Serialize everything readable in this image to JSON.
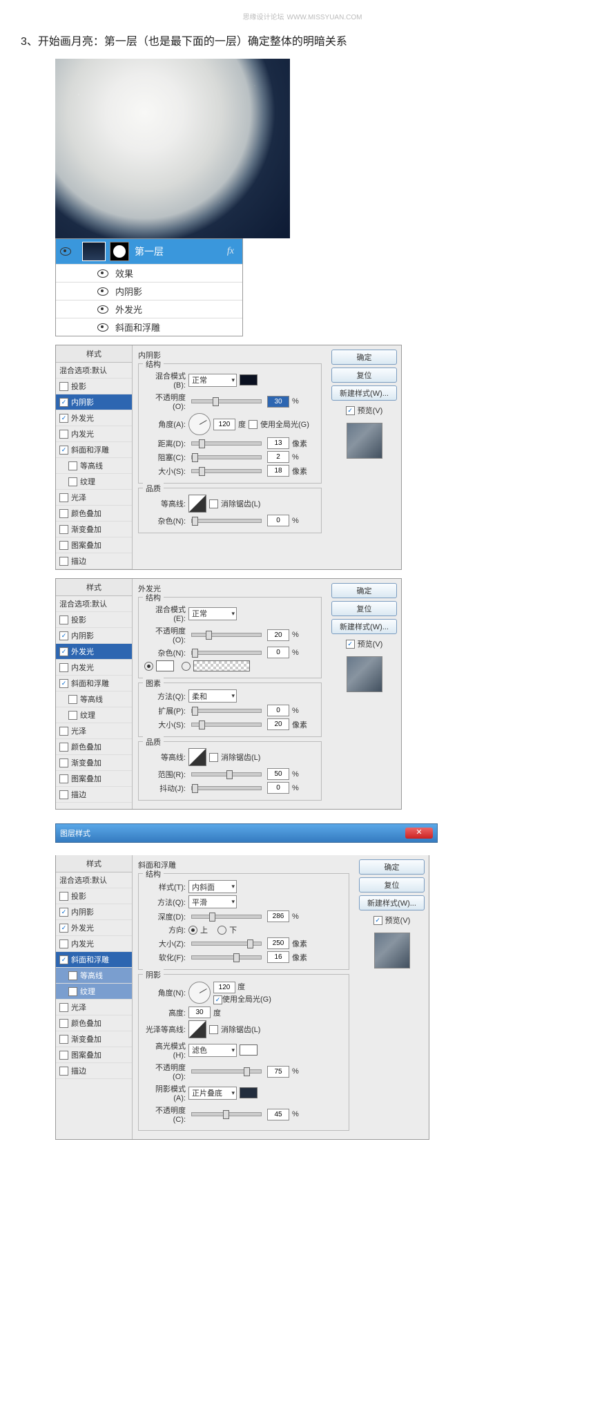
{
  "watermark": {
    "text": "思缘设计论坛",
    "url": "WWW.MISSYUAN.COM"
  },
  "step": "3、开始画月亮：第一层（也是最下面的一层）确定整体的明暗关系",
  "layers": {
    "name": "第一层",
    "fx": "fx",
    "effects_label": "效果",
    "fx_items": [
      "内阴影",
      "外发光",
      "斜面和浮雕"
    ]
  },
  "style_list": {
    "header": "样式",
    "blend_default": "混合选项:默认",
    "items": {
      "drop_shadow": "投影",
      "inner_shadow": "内阴影",
      "outer_glow": "外发光",
      "inner_glow": "内发光",
      "bevel": "斜面和浮雕",
      "contour": "等高线",
      "texture": "纹理",
      "gloss": "光泽",
      "color_overlay": "颜色叠加",
      "grad_overlay": "渐变叠加",
      "pattern_overlay": "图案叠加",
      "stroke": "描边"
    }
  },
  "buttons": {
    "ok": "确定",
    "reset": "复位",
    "new_style": "新建样式(W)...",
    "preview": "预览(V)"
  },
  "inner_shadow": {
    "title": "内阴影",
    "struct": "结构",
    "blend_mode_label": "混合模式(B):",
    "blend_mode": "正常",
    "opacity_label": "不透明度(O):",
    "opacity": "30",
    "opacity_unit": "%",
    "angle_label": "角度(A):",
    "angle": "120",
    "angle_unit": "度",
    "global_light": "使用全局光(G)",
    "distance_label": "距离(D):",
    "distance": "13",
    "px": "像素",
    "spread_label": "阻塞(C):",
    "spread": "2",
    "spread_unit": "%",
    "size_label": "大小(S):",
    "size": "18",
    "quality": "品质",
    "contour_label": "等高线:",
    "aa": "消除锯齿(L)",
    "noise_label": "杂色(N):",
    "noise": "0"
  },
  "outer_glow": {
    "title": "外发光",
    "struct": "结构",
    "blend_mode_label": "混合模式(E):",
    "blend_mode": "正常",
    "opacity_label": "不透明度(O):",
    "opacity": "20",
    "pct": "%",
    "noise_label": "杂色(N):",
    "noise": "0",
    "elements": "图素",
    "method_label": "方法(Q):",
    "method": "柔和",
    "spread_label": "扩展(P):",
    "spread": "0",
    "size_label": "大小(S):",
    "size": "20",
    "px": "像素",
    "quality": "品质",
    "contour_label": "等高线:",
    "aa": "消除锯齿(L)",
    "range_label": "范围(R):",
    "range": "50",
    "jitter_label": "抖动(J):",
    "jitter": "0"
  },
  "bevel": {
    "win_title": "图层样式",
    "title": "斜面和浮雕",
    "struct": "结构",
    "style_label": "样式(T):",
    "style": "内斜面",
    "method_label": "方法(Q):",
    "method": "平滑",
    "depth_label": "深度(D):",
    "depth": "286",
    "pct": "%",
    "direction_label": "方向:",
    "up": "上",
    "down": "下",
    "size_label": "大小(Z):",
    "size": "250",
    "px": "像素",
    "soften_label": "软化(F):",
    "soften": "16",
    "shade": "阴影",
    "angle_label": "角度(N):",
    "angle": "120",
    "deg": "度",
    "global_light": "使用全局光(G)",
    "altitude_label": "高度:",
    "altitude": "30",
    "gloss_contour_label": "光泽等高线:",
    "aa": "消除锯齿(L)",
    "hmode_label": "高光模式(H):",
    "hmode": "滤色",
    "hopacity_label": "不透明度(O):",
    "hopacity": "75",
    "smode_label": "阴影模式(A):",
    "smode": "正片叠底",
    "sopacity_label": "不透明度(C):",
    "sopacity": "45"
  }
}
